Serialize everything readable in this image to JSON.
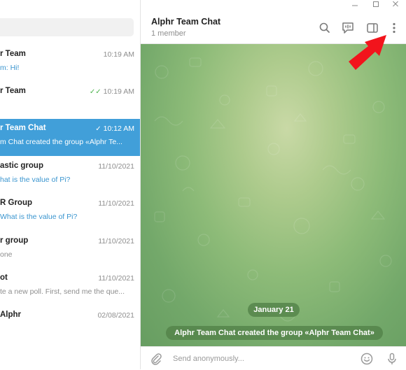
{
  "window": {
    "minimize_icon": "minimize-icon",
    "maximize_icon": "maximize-icon",
    "close_icon": "close-icon"
  },
  "chat_list": [
    {
      "name": "r Team",
      "time": "10:19 AM",
      "message": "m: Hi!",
      "message_style": "blue",
      "checks": ""
    },
    {
      "name": "r Team",
      "time": "10:19 AM",
      "message": "",
      "message_style": "grey",
      "checks": "✓✓"
    },
    {
      "name": "r Team Chat",
      "time": "10:12 AM",
      "message": "m Chat created the group «Alphr Te...",
      "message_style": "grey",
      "checks": "✓",
      "active": true
    },
    {
      "name": "astic group",
      "time": "11/10/2021",
      "message": "hat is the value of Pi?",
      "message_style": "blue",
      "checks": ""
    },
    {
      "name": "R Group",
      "time": "11/10/2021",
      "message": "What is the value of Pi?",
      "message_style": "blue",
      "checks": ""
    },
    {
      "name": "r group",
      "time": "11/10/2021",
      "message": "one",
      "message_style": "grey",
      "checks": ""
    },
    {
      "name": "ot",
      "time": "11/10/2021",
      "message": "te a new poll. First, send me the que...",
      "message_style": "grey",
      "checks": ""
    },
    {
      "name": "Alphr",
      "time": "02/08/2021",
      "message": "",
      "message_style": "grey",
      "checks": ""
    }
  ],
  "header": {
    "title": "Alphr Team Chat",
    "subtitle": "1 member",
    "icons": [
      "search-icon",
      "voice-chat-icon",
      "sidebar-toggle-icon",
      "more-vertical-icon"
    ]
  },
  "chat": {
    "date_label": "January 21",
    "service_message": "Alphr Team Chat created the group «Alphr Team Chat»"
  },
  "composer": {
    "placeholder": "Send anonymously...",
    "icons": [
      "attach-icon",
      "emoji-icon",
      "microphone-icon"
    ]
  },
  "colors": {
    "accent": "#419fd9",
    "annotation_arrow": "#f2141c",
    "chat_bg": "#8dbb78"
  }
}
